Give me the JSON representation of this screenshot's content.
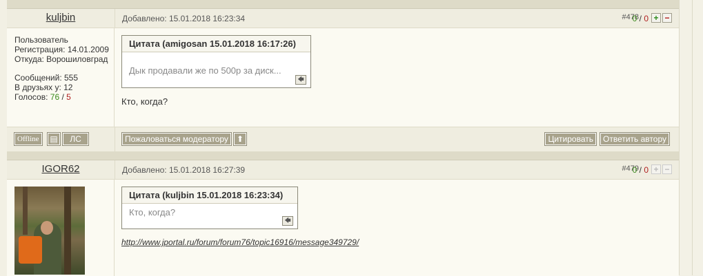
{
  "posts": [
    {
      "author": "kuljbin",
      "added": "Добавлено: 15.01.2018 16:23:34",
      "msg_no": "#478",
      "votes_pos": "0",
      "votes_sep": " / ",
      "votes_neg": "0",
      "info": {
        "role": "Пользователь",
        "registered": "Регистрация: 14.01.2009",
        "from": "Откуда: Ворошиловград",
        "messages": "Сообщений: 555",
        "friends": "В друзьях у: 12",
        "votes_label": "Голосов: ",
        "votes_pos": "76",
        "votes_sep": " / ",
        "votes_neg": "5"
      },
      "quote": {
        "title": "Цитата (amigosan 15.01.2018 16:17:26)",
        "text": "Дык продавали же по 500р за диск..."
      },
      "text": "Кто, когда?",
      "footer": {
        "offline": "Offline",
        "pm": "ЛС",
        "report": "Пожаловаться модератору",
        "quote": "Цитировать",
        "reply": "Ответить автору"
      }
    },
    {
      "author": "IGOR62",
      "added": "Добавлено: 15.01.2018 16:27:39",
      "msg_no": "#479",
      "votes_pos": "0",
      "votes_sep": " / ",
      "votes_neg": "0",
      "quote": {
        "title": "Цитата (kuljbin 15.01.2018 16:23:34)",
        "text": "Кто, когда?"
      },
      "link": "http://www.jportal.ru/forum/forum76/topic16916/message349729/"
    }
  ],
  "icons": {
    "plus": "+",
    "minus": "−",
    "quote_back": "🡄",
    "profile": "▤",
    "up": "⬆"
  },
  "colors": {
    "positive": "#3a8a1c",
    "negative": "#b02020",
    "button_bg": "#a8a38c"
  }
}
